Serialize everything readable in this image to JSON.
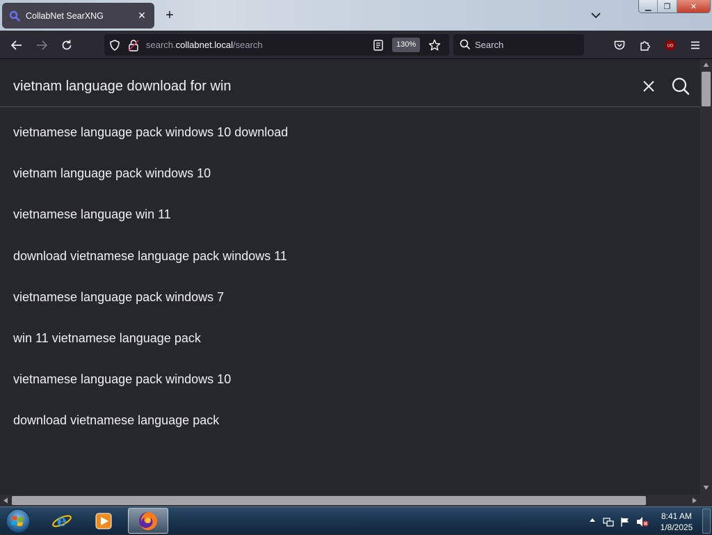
{
  "browser": {
    "tab": {
      "title": "CollabNet SearXNG",
      "close_glyph": "✕",
      "favicon": "search-favicon",
      "favicon_color": "#5a5ff0"
    },
    "new_tab_glyph": "+",
    "url": {
      "domain_prefix": "search.",
      "domain": "collabnet.local",
      "path": "/search"
    },
    "zoom": "130%",
    "search_placeholder": "Search",
    "window_controls": {
      "minimize": "▁",
      "maximize": "❐",
      "close": "✕"
    }
  },
  "page": {
    "query": "vietnam language download for win",
    "suggestions": [
      "vietnamese language pack windows 10 download",
      "vietnam language pack windows 10",
      "vietnamese language win 11",
      "download vietnamese language pack windows 11",
      "vietnamese language pack windows 7",
      "win 11 vietnamese language pack",
      "vietnamese language pack windows 10",
      "download vietnamese language pack"
    ]
  },
  "taskbar": {
    "pinned": [
      "internet-explorer",
      "media-player",
      "firefox"
    ],
    "active": "firefox",
    "clock": {
      "time": "8:41 AM",
      "date": "1/8/2025"
    }
  },
  "colors": {
    "page_bg": "#26272d",
    "toolbar_bg": "#2b2a33",
    "field_bg": "#1c1b22",
    "text": "#f0f0f2",
    "ublock_red": "#8b0000"
  }
}
